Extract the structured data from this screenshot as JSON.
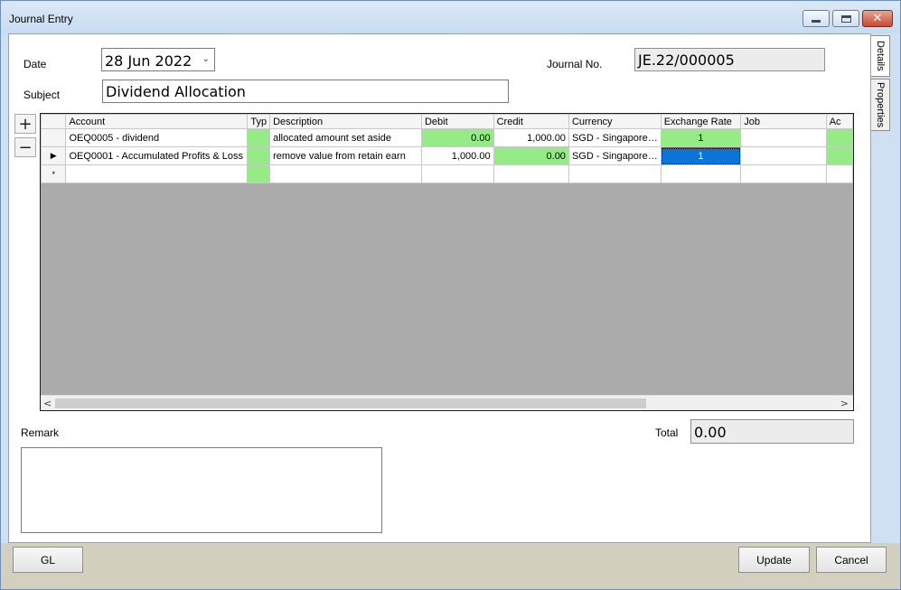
{
  "window": {
    "title": "Journal Entry"
  },
  "side_tabs": [
    "Details",
    "Properties"
  ],
  "form": {
    "date_label": "Date",
    "date_value": "28 Jun 2022",
    "subject_label": "Subject",
    "subject_value": "Dividend Allocation",
    "journal_no_label": "Journal No.",
    "journal_no_value": "JE.22/000005"
  },
  "row_buttons": {
    "add": "+",
    "remove": "−"
  },
  "grid": {
    "columns": [
      "Account",
      "Typ",
      "Description",
      "Debit",
      "Credit",
      "Currency",
      "Exchange Rate",
      "Job",
      "Ac"
    ],
    "rows": [
      {
        "indicator": "",
        "account": "OEQ0005 - dividend",
        "type": "",
        "description": "allocated amount set aside",
        "debit": "0.00",
        "credit": "1,000.00",
        "currency": "SGD - Singapore…",
        "exchange_rate": "1",
        "job": "",
        "ac": ""
      },
      {
        "indicator": "▶",
        "account": "OEQ0001 - Accumulated Profits & Loss",
        "type": "",
        "description": "remove value from retain earn",
        "debit": "1,000.00",
        "credit": "0.00",
        "currency": "SGD - Singapore…",
        "exchange_rate": "1",
        "job": "",
        "ac": ""
      }
    ],
    "new_row_indicator": "*",
    "scroll_left": "<",
    "scroll_right": ">"
  },
  "remark_label": "Remark",
  "remark_value": "",
  "total_label": "Total",
  "total_value": "0.00",
  "buttons": {
    "gl": "GL",
    "update": "Update",
    "cancel": "Cancel"
  },
  "colors": {
    "required_cell": "#95ec86",
    "selected_cell": "#0a74d8",
    "footer": "#d4d0c0"
  }
}
